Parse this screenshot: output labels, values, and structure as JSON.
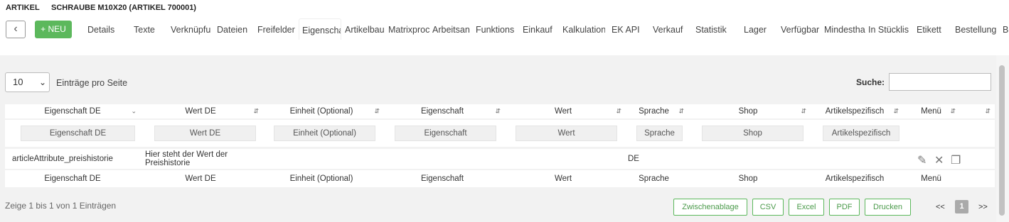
{
  "header": {
    "section": "ARTIKEL",
    "title": "SCHRAUBE M10X20 (ARTIKEL 700001)"
  },
  "toolbar": {
    "back_icon": "chevron-left-icon",
    "new_label": "+ NEU"
  },
  "tabs": [
    {
      "label": "Details"
    },
    {
      "label": "Texte"
    },
    {
      "label": "Verknüpfu"
    },
    {
      "label": "Dateien"
    },
    {
      "label": "Freifelder"
    },
    {
      "label": "Eigenscha"
    },
    {
      "label": "Artikelbau"
    },
    {
      "label": "Matrixproc"
    },
    {
      "label": "Arbeitsan"
    },
    {
      "label": "Funktions"
    },
    {
      "label": "Einkauf"
    },
    {
      "label": "Kalkulation"
    },
    {
      "label": "EK API"
    },
    {
      "label": "Verkauf"
    },
    {
      "label": "Statistik"
    },
    {
      "label": "Lager"
    },
    {
      "label": "Verfügbar"
    },
    {
      "label": "Mindestha"
    },
    {
      "label": "In Stücklis"
    },
    {
      "label": "Etikett"
    },
    {
      "label": "Bestellung"
    },
    {
      "label": "B"
    }
  ],
  "table_controls": {
    "page_length": "10",
    "page_length_label": "Einträge pro Seite",
    "search_label": "Suche:",
    "search_value": ""
  },
  "columns": [
    "Eigenschaft DE",
    "Wert DE",
    "Einheit (Optional)",
    "Eigenschaft",
    "Wert",
    "Sprache",
    "Shop",
    "Artikelspezifisch",
    "Menü"
  ],
  "filters": [
    "Eigenschaft DE",
    "Wert DE",
    "Einheit (Optional)",
    "Eigenschaft",
    "Wert",
    "Sprache",
    "Shop",
    "Artikelspezifisch"
  ],
  "rows": [
    {
      "eigenschaft_de": "articleAttribute_preishistorie",
      "wert_de_1": "Hier steht der Wert der",
      "wert_de_2": "Preishistorie",
      "einheit": "",
      "eigenschaft": "",
      "wert": "",
      "sprache": "DE",
      "shop": "",
      "artikelspezifisch": ""
    }
  ],
  "footer": {
    "info": "Zeige 1 bis 1 von 1 Einträgen",
    "buttons": [
      "Zwischenablage",
      "CSV",
      "Excel",
      "PDF",
      "Drucken"
    ],
    "prev": "<<",
    "current_page": "1",
    "next": ">>"
  },
  "icons": {
    "edit": "pencil-icon",
    "delete": "close-icon",
    "copy": "copy-icon"
  },
  "colors": {
    "accent": "#5cb85c"
  }
}
